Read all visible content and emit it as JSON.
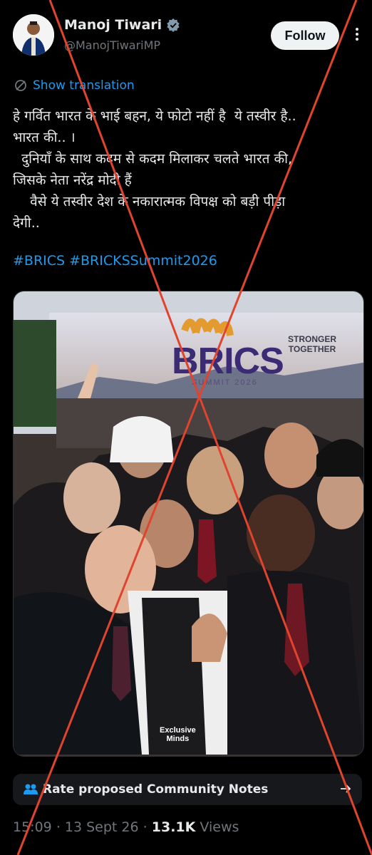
{
  "author": {
    "name": "Manoj Tiwari",
    "handle": "@ManojTiwariMP",
    "verified_icon": "verified-badge-icon",
    "follow_label": "Follow"
  },
  "tweet": {
    "translate_label": "Show translation",
    "text": "हे गर्वित भारत के भाई बहन, ये फोटो नहीं है  ये तस्वीर है..\nभारत की.. ।\n  दुनियाँ के साथ कदम से कदम मिलाकर चलते भारत की,\nजिसके नेता नरेंद्र मोदी हैं\n    वैसे ये तस्वीर देश के नकारात्मक विपक्ष को बड़ी पीड़ा\nदेगी..",
    "hashtags": [
      "#BRICS",
      "#BRICKSSummit2026"
    ]
  },
  "photo": {
    "banner_logo": "BRICS",
    "banner_year": "SUMMIT 2026",
    "banner_slogan_line1": "STRONGER",
    "banner_slogan_line2": "TOGETHER",
    "watermark_line1": "Exclusive",
    "watermark_line2": "Minds"
  },
  "community_notes": {
    "label": "Rate proposed Community Notes"
  },
  "meta": {
    "time": "15:09",
    "separator": "·",
    "date": "13 Sept 26",
    "views_count": "13.1K",
    "views_label": "Views"
  },
  "overlay": {
    "cross_color": "#e0442e"
  }
}
